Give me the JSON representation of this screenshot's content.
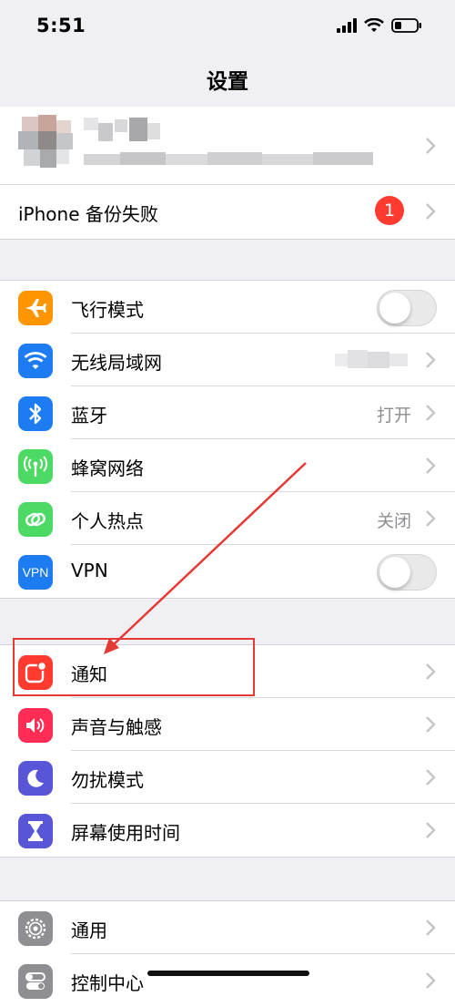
{
  "status": {
    "time": "5:51"
  },
  "nav": {
    "title": "设置"
  },
  "profile": {},
  "backup": {
    "label": "iPhone 备份失败",
    "badge": "1"
  },
  "connectivity": [
    {
      "label": "飞行模式"
    },
    {
      "label": "无线局域网"
    },
    {
      "label": "蓝牙",
      "value": "打开"
    },
    {
      "label": "蜂窝网络"
    },
    {
      "label": "个人热点",
      "value": "关闭"
    },
    {
      "label": "VPN",
      "icon_text": "VPN"
    }
  ],
  "notifications_group": [
    {
      "label": "通知"
    },
    {
      "label": "声音与触感"
    },
    {
      "label": "勿扰模式"
    },
    {
      "label": "屏幕使用时间"
    }
  ],
  "general_group": [
    {
      "label": "通用"
    },
    {
      "label": "控制中心"
    }
  ],
  "toggles": {
    "airplane_mode": false,
    "vpn": false
  },
  "colors": {
    "airplane": "#ff9500",
    "wifi": "#1e7cf2",
    "bluetooth": "#1e7cf2",
    "cellular": "#4cd964",
    "hotspot": "#4cd964",
    "vpn": "#1e7cf2",
    "notifications": "#ff3b30",
    "sounds": "#ff2d55",
    "do_not_disturb": "#5856d6",
    "screen_time": "#5856d6",
    "general": "#8e8e93",
    "annotation": "#e53935"
  },
  "icons": {
    "airplane": "airplane-icon",
    "wifi": "wifi-icon",
    "bluetooth": "bluetooth-icon",
    "cellular": "cellular-antenna-icon",
    "hotspot": "hotspot-link-icon",
    "vpn": "vpn-icon",
    "notifications": "notification-icon",
    "sounds": "speaker-icon",
    "do_not_disturb": "moon-icon",
    "screen_time": "hourglass-icon",
    "general": "gear-icon",
    "control_center": "toggles-icon"
  }
}
